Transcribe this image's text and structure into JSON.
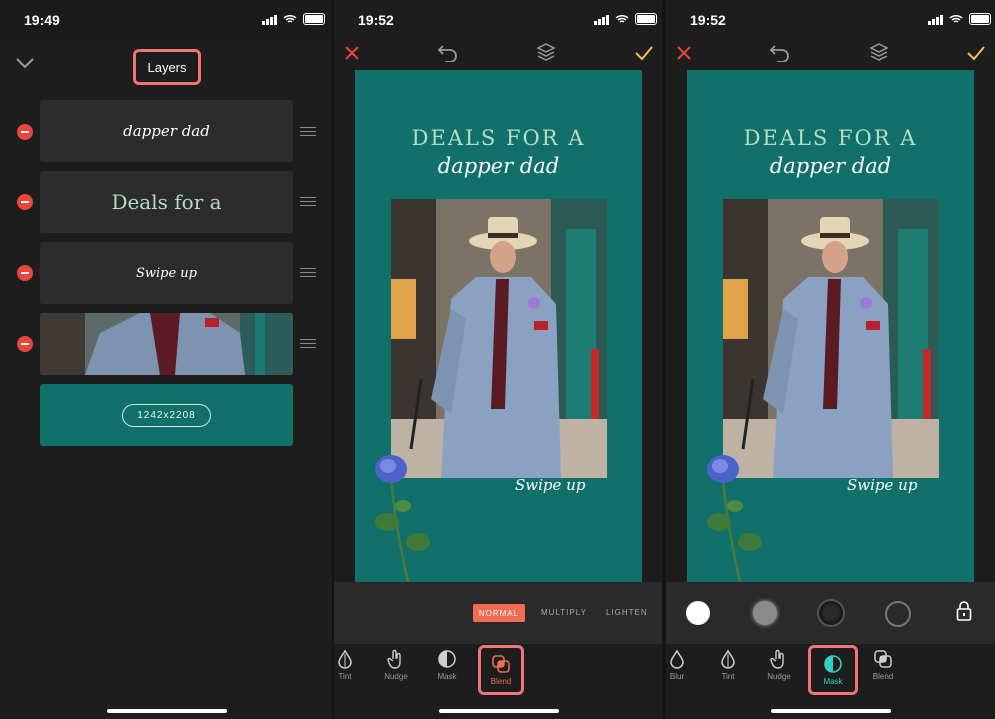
{
  "panels": [
    {
      "time": "19:49"
    },
    {
      "time": "19:52"
    },
    {
      "time": "19:52"
    }
  ],
  "layers_panel": {
    "title": "Layers",
    "layers": [
      {
        "label": "dapper dad"
      },
      {
        "label": "Deals for a"
      },
      {
        "label": "Swipe up"
      },
      {
        "label": ""
      }
    ],
    "background_size": "1242x2208"
  },
  "design": {
    "headline": "DEALS FOR A",
    "subheadline": "dapper dad",
    "swipe_text": "Swipe up",
    "background_color": "#12706a"
  },
  "blend_modes": {
    "options": [
      "NORMAL",
      "MULTIPLY",
      "LIGHTEN"
    ],
    "selected": "NORMAL"
  },
  "toolbar_blend": {
    "tools": [
      "Tint",
      "Nudge",
      "Mask",
      "Blend"
    ],
    "active": "Blend"
  },
  "toolbar_mask": {
    "tools": [
      "Blur",
      "Tint",
      "Nudge",
      "Mask",
      "Blend"
    ],
    "active": "Mask"
  },
  "colors": {
    "highlight": "#f07478",
    "accent_orange": "#f26b53",
    "accent_teal": "#2fd3bf",
    "confirm": "#f2c14e",
    "close": "#e8453c"
  }
}
